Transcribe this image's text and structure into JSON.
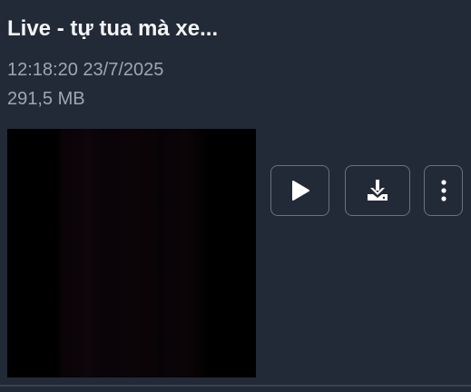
{
  "item": {
    "title": "Live - tự tua mà xe...",
    "timestamp": "12:18:20 23/7/2025",
    "size": "291,5 MB"
  },
  "actions": {
    "play_icon": "play-icon",
    "download_icon": "download-icon",
    "more_icon": "more-vertical-icon"
  },
  "colors": {
    "background": "#232a37",
    "title_text": "#f3f5f8",
    "meta_text": "#9ea6b4",
    "button_border": "#69717f",
    "icon": "#ffffff"
  }
}
